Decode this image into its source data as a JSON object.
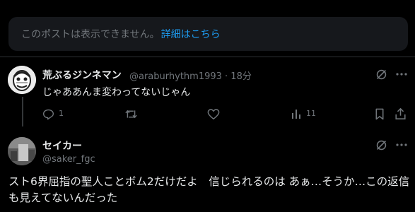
{
  "notice": {
    "text": "このポストは表示できません。",
    "link": "詳細はこちら"
  },
  "reply": {
    "display_name": "荒ぶるジンネマン",
    "handle_time": "@araburhythm1993 · 18分",
    "text": "じゃああんま変わってないじゃん",
    "reply_count": "1",
    "view_count": "11"
  },
  "main_post": {
    "display_name": "セイカー",
    "handle": "@saker_fgc",
    "text": "スト6界屈指の聖人ことボム2だけだよ　信じられるのは あぁ…そうか…この返信も見えてないんだった"
  },
  "colors": {
    "background": "#000000",
    "accent": "#1d9bf0",
    "muted": "#71767b",
    "card": "#16181c"
  }
}
